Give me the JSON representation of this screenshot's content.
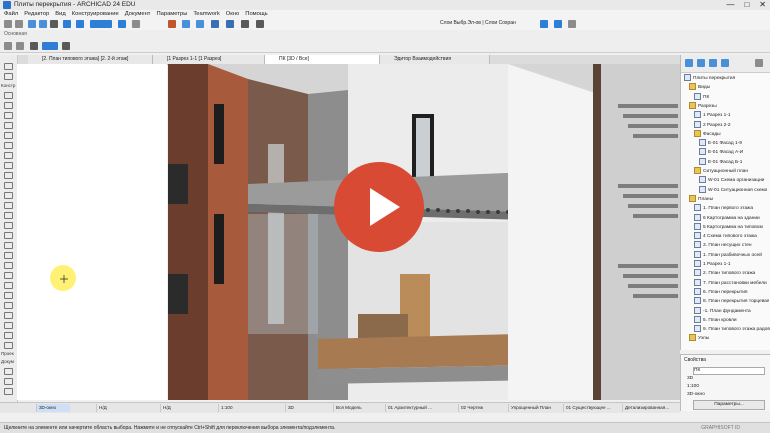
{
  "window": {
    "title": "Плиты перекрытия - ARCHICAD 24 EDU",
    "controls": [
      "—",
      "□",
      "✕"
    ]
  },
  "menu": [
    "Файл",
    "Редактор",
    "Вид",
    "Конструирование",
    "Документ",
    "Параметры",
    "Teamwork",
    "Окно",
    "Помощь"
  ],
  "toolbar": {
    "layer_combo": "Слои Выбр.Эл-ов | Слои Сохран"
  },
  "info_box": {
    "label": "Основная"
  },
  "tabs": [
    {
      "label": "[2. План типового этажа] [2. 2-й этаж]",
      "active": false
    },
    {
      "label": "[1 Разрез 1-1 [1 Разрез]",
      "active": false
    },
    {
      "label": "[3D / Все]",
      "active": true,
      "prefix": "ПК"
    },
    {
      "label": "Эдитор Взаимодействия",
      "active": false
    }
  ],
  "toolbox": {
    "label_construct": "Констр",
    "label_docs": "Проек",
    "label_more": "Докум"
  },
  "navigator": {
    "items": [
      {
        "text": "Плиты перекрытия",
        "type": "file"
      },
      {
        "text": "Виды",
        "type": "folder"
      },
      {
        "text": "ПК",
        "type": "view"
      },
      {
        "text": "Разрезы",
        "type": "folder"
      },
      {
        "text": "1 Разрез 1-1",
        "type": "view"
      },
      {
        "text": "2 Разрез 2-2",
        "type": "view"
      },
      {
        "text": "Фасады",
        "type": "folder"
      },
      {
        "text": "Е-01 Фасад 1-9",
        "type": "view"
      },
      {
        "text": "Е-01 Фасад А-И",
        "type": "view"
      },
      {
        "text": "Е-01 Фасад Б-1",
        "type": "view"
      },
      {
        "text": "Ситуационный план",
        "type": "folder"
      },
      {
        "text": "W-01 Схема организации",
        "type": "view"
      },
      {
        "text": "W-01 Ситуационная схема",
        "type": "view"
      },
      {
        "text": "Планы",
        "type": "folder"
      },
      {
        "text": "1. План первого этажа",
        "type": "view"
      },
      {
        "text": "6 Картограмма на здании",
        "type": "view"
      },
      {
        "text": "5 Картограмма на типовом",
        "type": "view"
      },
      {
        "text": "4 Схема типового этажа",
        "type": "view"
      },
      {
        "text": "3. План несущих стен",
        "type": "view"
      },
      {
        "text": "1. План разбивочных осей",
        "type": "view"
      },
      {
        "text": "1 Разрез 1-1",
        "type": "view"
      },
      {
        "text": "2. План типового этажа",
        "type": "view"
      },
      {
        "text": "7. План расстановки мебели",
        "type": "view"
      },
      {
        "text": "6. План перекрытия",
        "type": "view"
      },
      {
        "text": "8. План перекрытия торцевая",
        "type": "view"
      },
      {
        "text": "-1. План фундамента",
        "type": "view"
      },
      {
        "text": "5. План кровли",
        "type": "view"
      },
      {
        "text": "9. План типового этажа радов",
        "type": "view"
      },
      {
        "text": "Узлы",
        "type": "folder"
      }
    ]
  },
  "properties": {
    "title": "Свойства",
    "name": "ПК",
    "id": "3D",
    "scale": "1:100",
    "view": "3D-окно",
    "button": "Параметры..."
  },
  "bottom_bar": [
    "3D-окно",
    "Н/Д",
    "Н/Д",
    "1:100",
    "3D",
    "Вся Модель",
    "01 Архитектурный ...",
    "02 Чертеж",
    "Упрощенный План",
    "01 Существующее ...",
    "Детализированная..."
  ],
  "status": {
    "text": "Щелкните на элементе или начертите область выбора. Нажмите и не отпускайте Ctrl+Shift для переключения выбора элемента/подэлемента.",
    "brand": "GRAPHISOFT ID"
  },
  "colors": {
    "accent": "#2b72c9",
    "play": "#d94a35",
    "folder": "#e9c35c"
  }
}
